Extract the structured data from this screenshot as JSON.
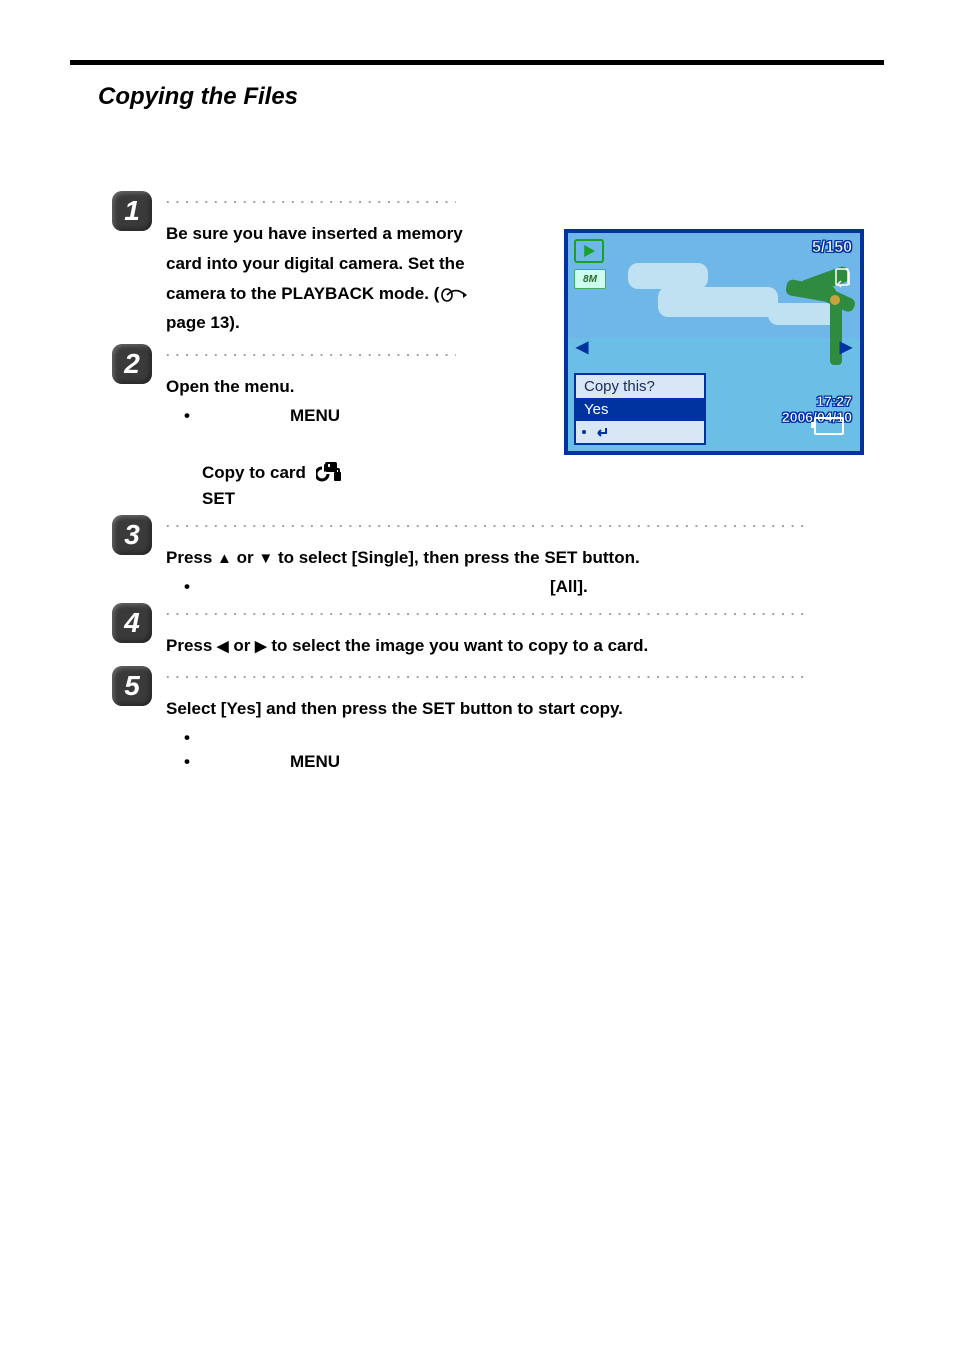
{
  "title": "Copying the Files",
  "lcd": {
    "counter": "5/150",
    "resolution": "8M",
    "dialog_title": "Copy this?",
    "dialog_yes": "Yes",
    "time": "17:27",
    "date": "2006/04/10"
  },
  "steps": {
    "s1": {
      "num": "1",
      "text": "Be sure you have inserted a memory card into your digital camera.   Set the camera to the PLAYBACK mode. (",
      "page_ref": "  page 13)."
    },
    "s2": {
      "num": "2",
      "text": "Open the menu.",
      "bullet_menu": "MENU",
      "copy_label": "Copy to card",
      "set_label": "SET"
    },
    "s3": {
      "num": "3",
      "text_a": "Press ",
      "text_b": " or ",
      "text_c": " to select [Single], then press the SET button.",
      "bullet_all": "[All]."
    },
    "s4": {
      "num": "4",
      "text_a": "Press ",
      "text_b": " or ",
      "text_c": " to select the image you want to copy to a card."
    },
    "s5": {
      "num": "5",
      "text": "Select [Yes] and then press the SET button to start copy.",
      "bullet2": "MENU"
    }
  },
  "dots_short": "....................................",
  "dots_long": "........................................................................"
}
